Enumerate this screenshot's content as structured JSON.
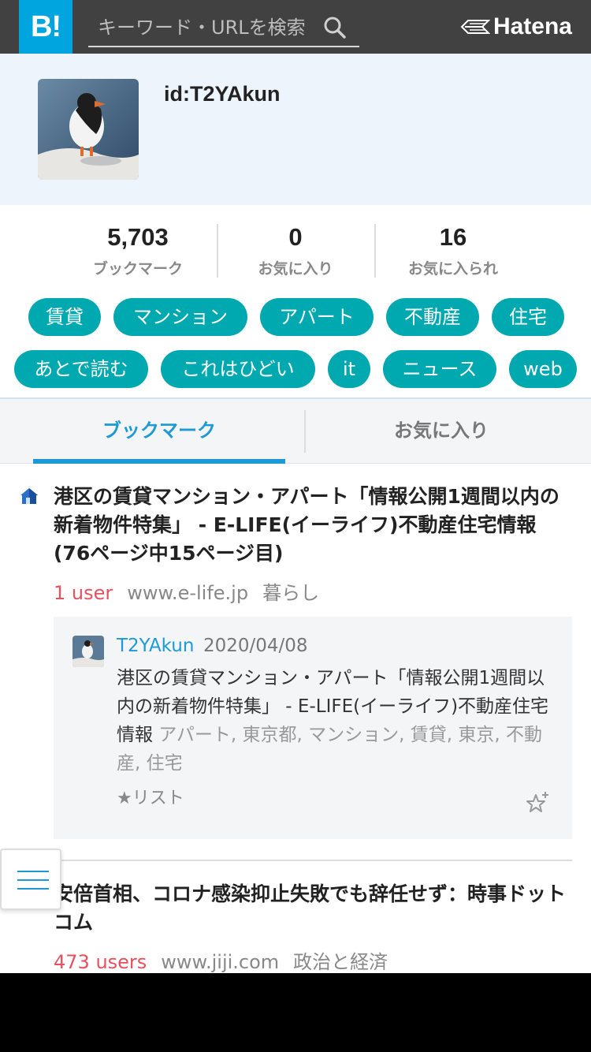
{
  "header": {
    "logo_text": "B!",
    "search_placeholder": "キーワード・URLを検索",
    "brand_name": "Hatena",
    "brand_color": "#00A4DE",
    "bar_color": "#414141"
  },
  "profile": {
    "id_text": "id:T2YAkun"
  },
  "stats": [
    {
      "number": "5,703",
      "label": "ブックマーク"
    },
    {
      "number": "0",
      "label": "お気に入り"
    },
    {
      "number": "16",
      "label": "お気に入られ"
    }
  ],
  "tags": {
    "color": "#00A8B0",
    "row1": [
      "賃貸",
      "マンション",
      "アパート",
      "不動産",
      "住宅"
    ],
    "row2": [
      "あとで読む",
      "これはひどい",
      "it",
      "ニュース",
      "web"
    ]
  },
  "tabs": {
    "active": "ブックマーク",
    "inactive": "お気に入り"
  },
  "entries": [
    {
      "title": "港区の賃貸マンション・アパート「情報公開1週間以内の新着物件特集」 - E-LIFE(イーライフ)不動産住宅情報(76ページ中15ページ目)",
      "users": "1 user",
      "domain": "www.e-life.jp",
      "category": "暮らし",
      "favicon": "house-icon",
      "comment": {
        "user": "T2YAkun",
        "date": "2020/04/08",
        "text": "港区の賃貸マンション・アパート「情報公開1週間以内の新着物件特集」 - E-LIFE(イーライフ)不動産住宅情報",
        "tags": "アパート, 東京都, マンション, 賃貸, 東京, 不動産, 住宅",
        "list_label": "★リスト"
      }
    },
    {
      "title": "安倍首相、コロナ感染抑止失敗でも辞任せず：時事ドットコム",
      "users": "473 users",
      "domain": "www.jiji.com",
      "category": "政治と経済"
    }
  ]
}
